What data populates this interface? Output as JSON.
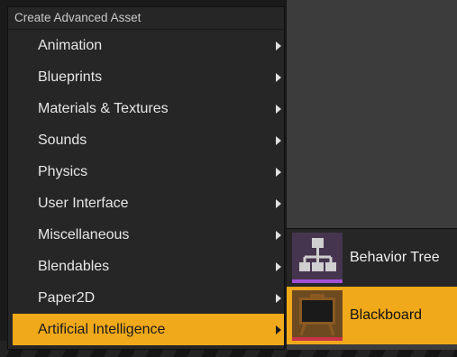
{
  "menu": {
    "header": "Create Advanced Asset",
    "items": [
      {
        "label": "Animation"
      },
      {
        "label": "Blueprints"
      },
      {
        "label": "Materials & Textures"
      },
      {
        "label": "Sounds"
      },
      {
        "label": "Physics"
      },
      {
        "label": "User Interface"
      },
      {
        "label": "Miscellaneous"
      },
      {
        "label": "Blendables"
      },
      {
        "label": "Paper2D"
      },
      {
        "label": "Artificial Intelligence"
      }
    ],
    "active_item": "Artificial Intelligence"
  },
  "submenu": {
    "items": [
      {
        "label": "Behavior Tree",
        "icon": "behavior-tree-icon"
      },
      {
        "label": "Blackboard",
        "icon": "blackboard-icon"
      }
    ],
    "active_item": "Blackboard"
  },
  "colors": {
    "accent": "#f0a91b",
    "menu_background": "#262626",
    "behavior_tree_accent": "#a24fd6",
    "blackboard_accent": "#c8324a"
  }
}
